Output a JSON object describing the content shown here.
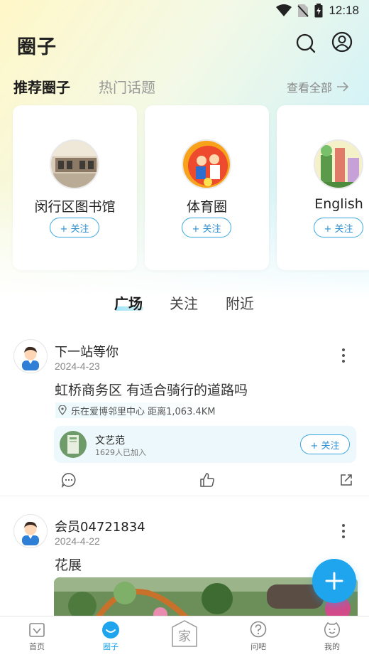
{
  "status_bar": {
    "time": "12:18"
  },
  "header": {
    "title": "圈子"
  },
  "subtabs": {
    "active": "推荐圈子",
    "inactive": "热门话题",
    "view_all": "查看全部"
  },
  "circles": [
    {
      "name": "闵行区图书馆",
      "follow_label": "+ 关注"
    },
    {
      "name": "体育圈",
      "follow_label": "+ 关注"
    },
    {
      "name": "English",
      "follow_label": "+ 关注"
    }
  ],
  "feed_tabs": [
    "广场",
    "关注",
    "附近"
  ],
  "posts": [
    {
      "user": "下一站等你",
      "date": "2024-4-23",
      "text": "虹桥商务区 有适合骑行的道路吗",
      "location": "乐在爱博邻里中心 距离1,063.4KM",
      "circle": {
        "name": "文艺范",
        "members": "1629人已加入",
        "follow_label": "+ 关注"
      }
    },
    {
      "user": "会员04721834",
      "date": "2024-4-22",
      "text": "花展"
    }
  ],
  "bottom_nav": [
    {
      "label": "首页",
      "icon": "home-icon"
    },
    {
      "label": "圈子",
      "icon": "circle-icon",
      "active": true
    },
    {
      "label": "家",
      "icon": "family-icon"
    },
    {
      "label": "问吧",
      "icon": "question-icon"
    },
    {
      "label": "我的",
      "icon": "smile-icon"
    }
  ],
  "colors": {
    "accent": "#1ea5ee",
    "follow_border": "#3aa6e0"
  }
}
